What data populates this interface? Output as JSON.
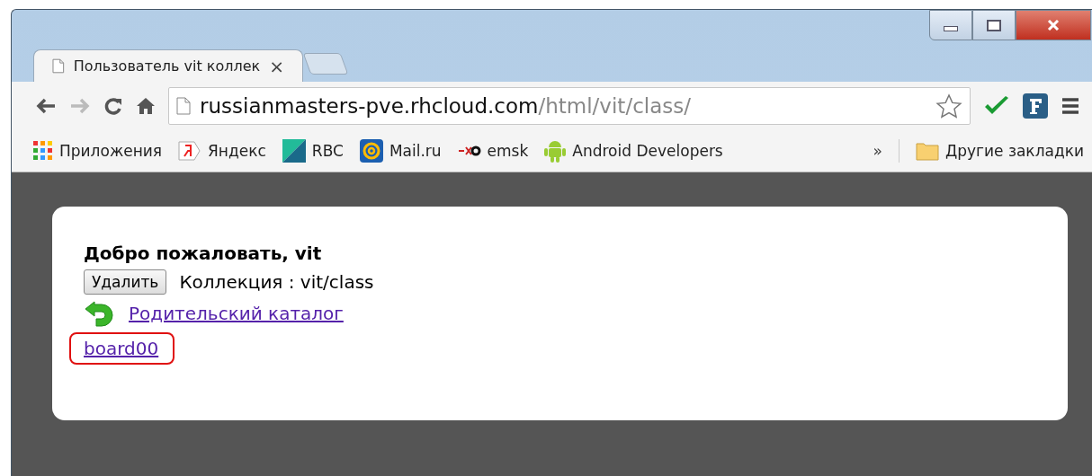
{
  "tab": {
    "title": "Пользователь vit коллек",
    "close": "×",
    "selected": true
  },
  "address": {
    "host": "russianmasters-pve.rhcloud.com",
    "path": "/html/vit/class/"
  },
  "bookmarks": [
    {
      "kind": "apps",
      "label": "Приложения"
    },
    {
      "kind": "yandex",
      "label": "Яндекс"
    },
    {
      "kind": "rbc",
      "label": "RBC"
    },
    {
      "kind": "mail",
      "label": "Mail.ru"
    },
    {
      "kind": "emsk",
      "label": "emsk"
    },
    {
      "kind": "android",
      "label": "Android Developers"
    }
  ],
  "bookmarks_more": "»",
  "other_bookmarks": "Другие закладки",
  "page": {
    "greeting": "Добро пожаловать, vit",
    "delete_button": "Удалить",
    "collection": "Коллекция : vit/class",
    "parent_link": "Родительский каталог",
    "links": [
      {
        "label": "board00",
        "highlighted": true
      }
    ]
  }
}
